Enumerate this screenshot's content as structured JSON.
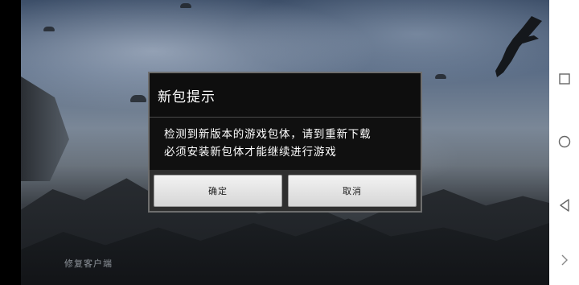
{
  "game": {
    "repair_label": "修复客户端"
  },
  "dialog": {
    "title": "新包提示",
    "message_lines": [
      "检测到新版本的游戏包体，请到重新下载",
      "必须安装新包体才能继续进行游戏"
    ],
    "confirm_label": "确定",
    "cancel_label": "取消"
  },
  "navbar": {
    "buttons": [
      {
        "icon": "square-icon",
        "meaning": "recent apps"
      },
      {
        "icon": "circle-icon",
        "meaning": "home"
      },
      {
        "icon": "triangle-back-icon",
        "meaning": "back"
      },
      {
        "icon": "chevron-right-icon",
        "meaning": "expand"
      }
    ]
  }
}
